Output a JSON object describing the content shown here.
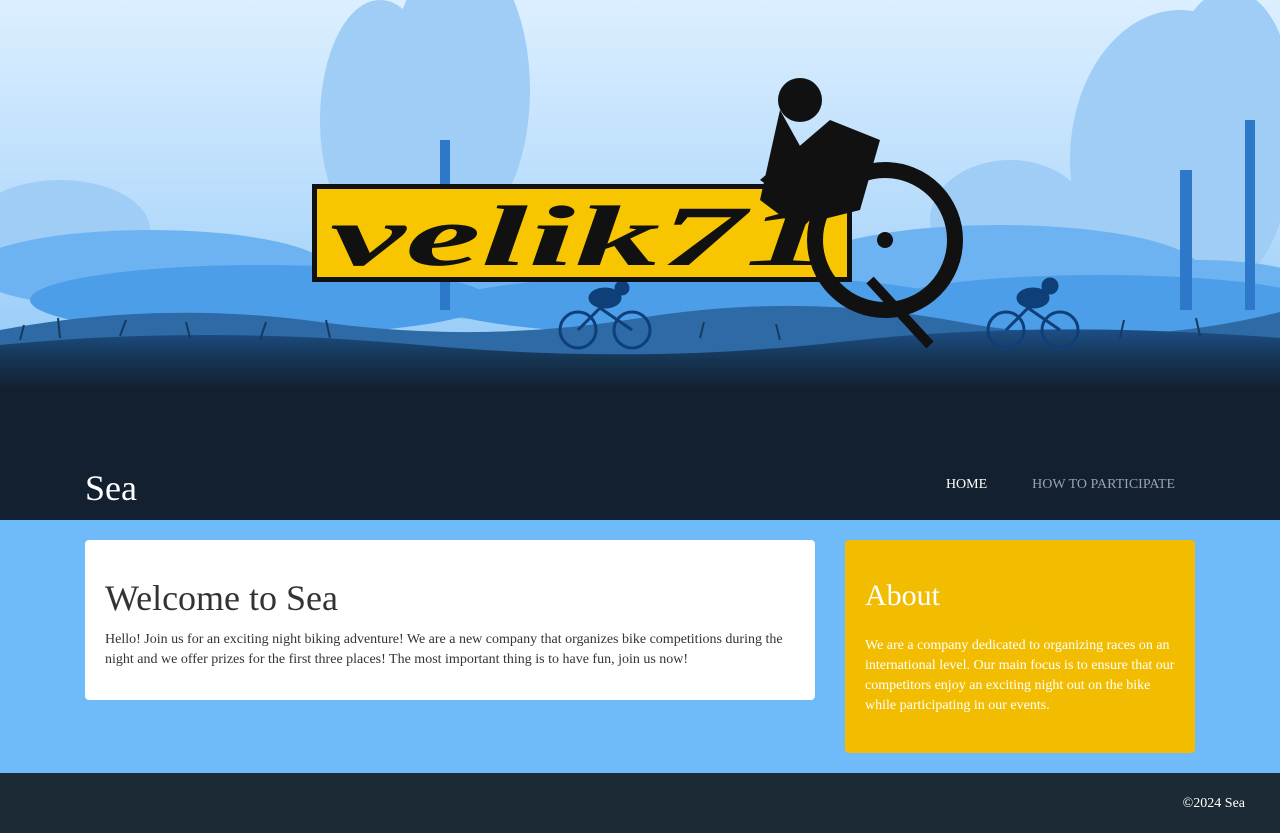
{
  "hero": {
    "logo_text": "velik71"
  },
  "header": {
    "brand": "Sea",
    "nav": [
      {
        "label": "HOME",
        "active": true
      },
      {
        "label": "HOW TO PARTICIPATE",
        "active": false
      }
    ]
  },
  "welcome": {
    "title": "Welcome to Sea",
    "text": "Hello! Join us for an exciting night biking adventure! We are a new company that organizes bike competitions during the night and we offer prizes for the first three places! The most important thing is to have fun, join us now!"
  },
  "about": {
    "title": "About",
    "text": "We are a company dedicated to organizing races on an international level. Our main focus is to ensure that our competitors enjoy an exciting night out on the bike while participating in our events."
  },
  "footer": {
    "copyright": "©2024 Sea"
  },
  "colors": {
    "hero_dark": "#132030",
    "main_bg": "#6fbaf9",
    "about_bg": "#f2bd00",
    "footer_bg": "#1b2a35",
    "logo_yellow": "#f7c600"
  }
}
